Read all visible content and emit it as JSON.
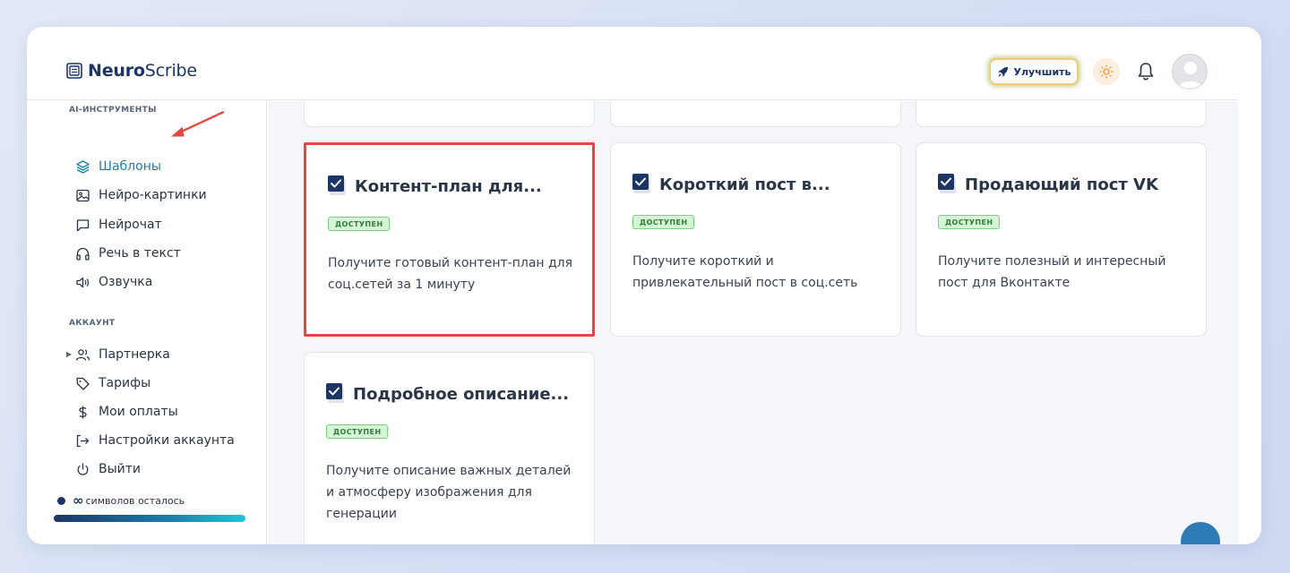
{
  "header": {
    "logo_bold": "Neuro",
    "logo_light": "Scribe",
    "upgrade_label": "Улучшить"
  },
  "sidebar": {
    "ai_section": "AI-ИНСТРУМЕНТЫ",
    "ai_items": [
      {
        "label": "Шаблоны",
        "icon": "layers-icon",
        "active": true
      },
      {
        "label": "Нейро-картинки",
        "icon": "image-icon",
        "active": false
      },
      {
        "label": "Нейрочат",
        "icon": "chat-icon",
        "active": false
      },
      {
        "label": "Речь в текст",
        "icon": "headphones-icon",
        "active": false
      },
      {
        "label": "Озвучка",
        "icon": "speaker-icon",
        "active": false
      }
    ],
    "account_section": "АККАУНТ",
    "account_items": [
      {
        "label": "Партнерка",
        "icon": "users-icon"
      },
      {
        "label": "Тарифы",
        "icon": "tag-icon"
      },
      {
        "label": "Мои оплаты",
        "icon": "dollar-icon"
      },
      {
        "label": "Настройки аккаунта",
        "icon": "login-icon"
      },
      {
        "label": "Выйти",
        "icon": "power-icon"
      }
    ],
    "symbols_value": "∞",
    "symbols_label": "символов осталось"
  },
  "cards": [
    {
      "title": "Контент-план для...",
      "badge": "ДОСТУПЕН",
      "description": "Получите готовый контент-план для соц.сетей за 1 минуту",
      "highlighted": true
    },
    {
      "title": "Короткий пост в...",
      "badge": "ДОСТУПЕН",
      "description": "Получите короткий и привлекательный пост в соц.сеть",
      "highlighted": false
    },
    {
      "title": "Продающий пост VK",
      "badge": "ДОСТУПЕН",
      "description": "Получите полезный и интересный пост для Вконтакте",
      "highlighted": false
    },
    {
      "title": "Подробное описание...",
      "badge": "ДОСТУПЕН",
      "description": "Получите описание важных деталей и атмосферу изображения для генерации",
      "highlighted": false
    }
  ],
  "colors": {
    "brand": "#1d3566",
    "accent": "#1d7ea8",
    "highlight": "#e5463f",
    "badge_bg": "#d6f5d6"
  }
}
